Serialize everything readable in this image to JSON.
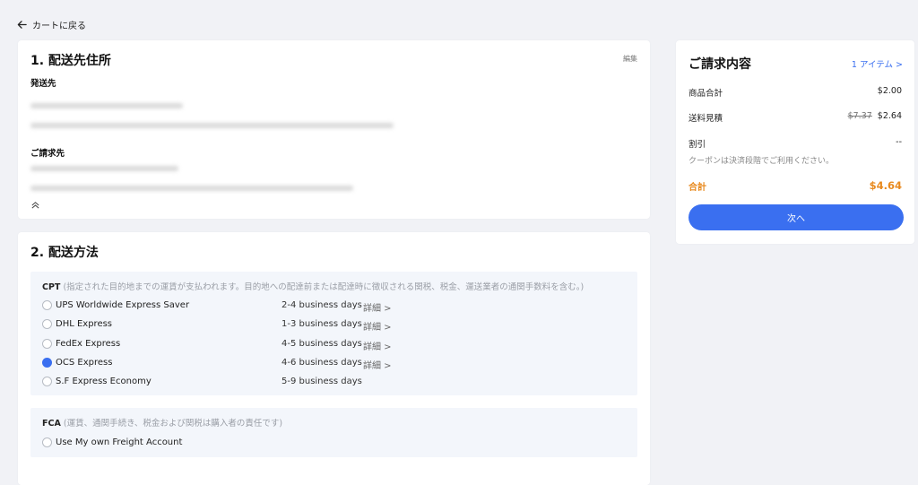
{
  "nav": {
    "back_label": "カートに戻る"
  },
  "address": {
    "title": "1. 配送先住所",
    "edit_label": "編集",
    "shipping_label": "発送先",
    "billing_label": "ご請求先"
  },
  "shipping": {
    "title": "2. 配送方法",
    "cpt": {
      "code": "CPT",
      "description": "(指定された目的地までの運賃が支払われます。目的地への配達前または配達時に徴収される関税、税金、運送業者の通関手数料を含む。)",
      "options": [
        {
          "name": "UPS Worldwide Express Saver",
          "days": "2-4 business days",
          "detail": "詳細 >",
          "selected": false
        },
        {
          "name": "DHL Express",
          "days": "1-3 business days",
          "detail": "詳細 >",
          "selected": false
        },
        {
          "name": "FedEx Express",
          "days": "4-5 business days",
          "detail": "詳細 >",
          "selected": false
        },
        {
          "name": "OCS Express",
          "days": "4-6 business days",
          "detail": "詳細 >",
          "selected": true
        },
        {
          "name": "S.F Express Economy",
          "days": "5-9 business days",
          "detail": "",
          "selected": false
        }
      ]
    },
    "fca": {
      "code": "FCA",
      "description": "(運賃、通関手続き、税金および関税は購入者の責任です)",
      "option": "Use My own Freight Account"
    }
  },
  "summary": {
    "title": "ご請求内容",
    "items_link": "1 アイテム >",
    "subtotal_label": "商品合計",
    "subtotal_value": "$2.00",
    "shipping_label": "送料見積",
    "shipping_original": "$7.37",
    "shipping_value": "$2.64",
    "discount_label": "割引",
    "discount_value": "--",
    "coupon_note": "クーポンは決済段階でご利用ください。",
    "total_label": "合計",
    "total_value": "$4.64",
    "next_label": "次へ"
  },
  "colors": {
    "accent": "#3a6ff0",
    "total": "#e88a1f",
    "background": "#f1f2f6"
  }
}
